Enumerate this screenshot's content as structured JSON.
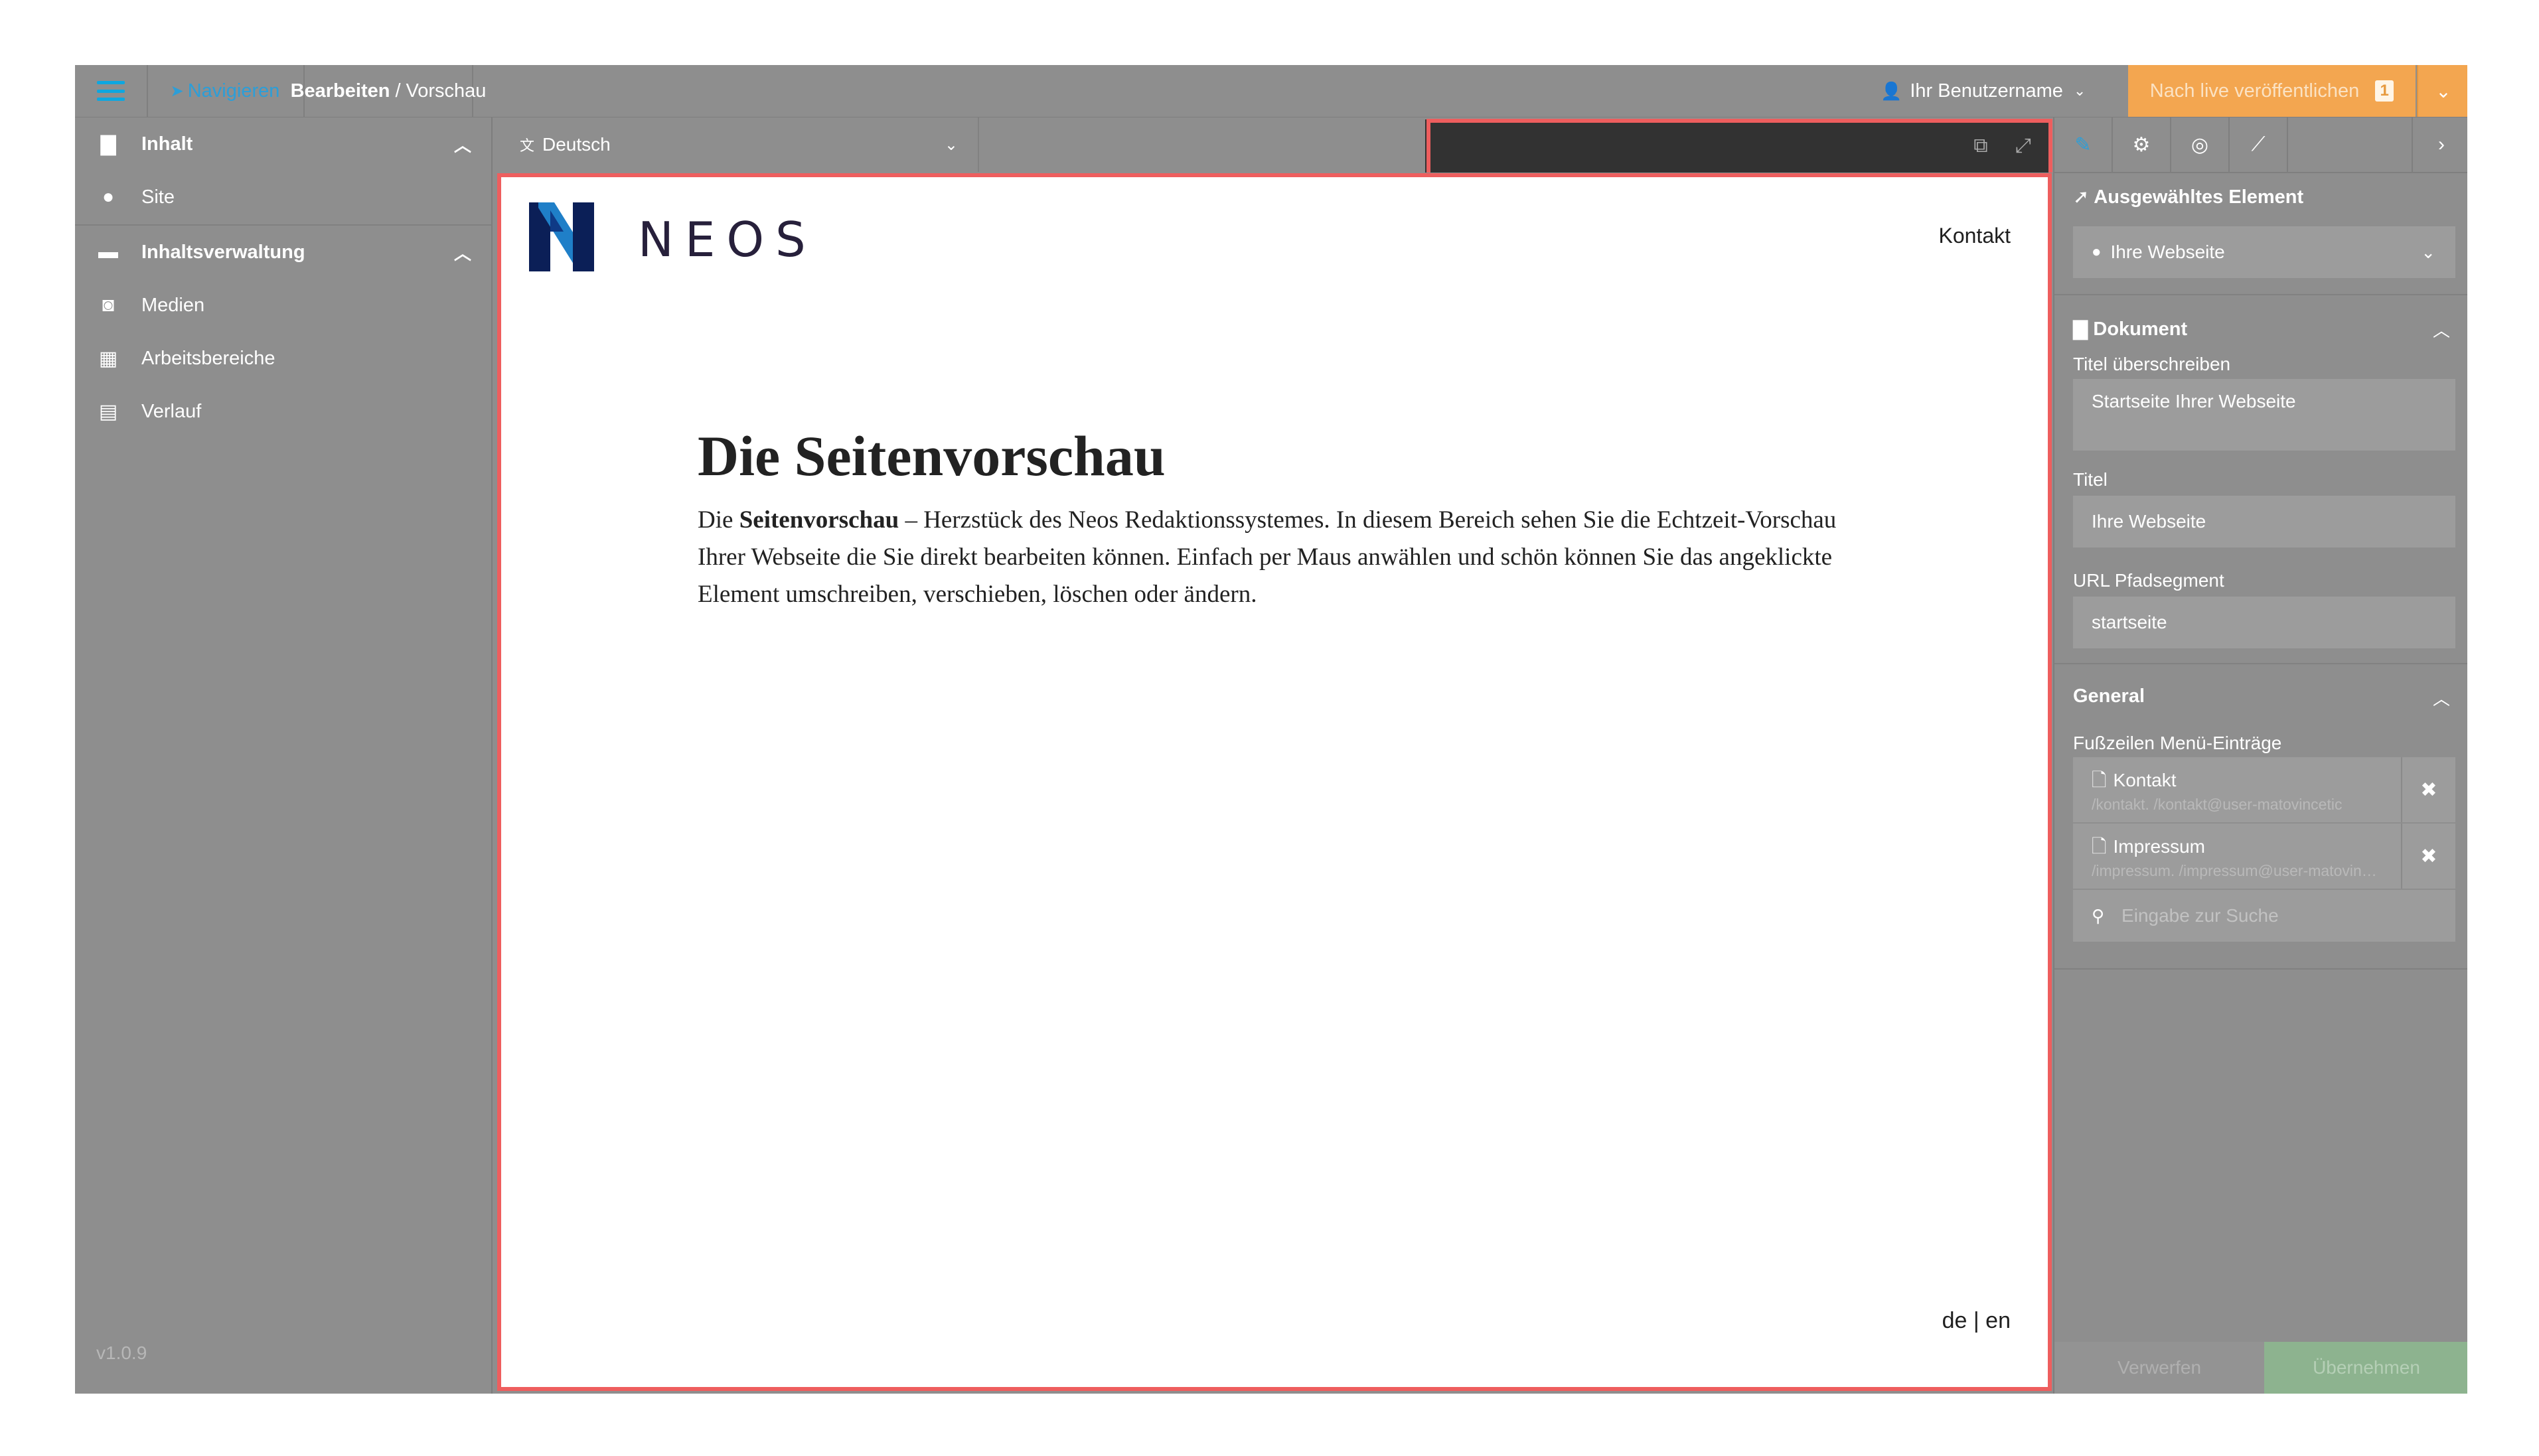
{
  "topbar": {
    "nav_label": "Navigieren",
    "crumb_bold": "Bearbeiten",
    "crumb_sep": "/",
    "crumb_rest": "Vorschau",
    "username": "Ihr Benutzername",
    "publish_label": "Nach live veröffentlichen",
    "publish_count": "1"
  },
  "sidebar": {
    "groups": [
      {
        "label": "Inhalt",
        "items": [
          "Site"
        ]
      },
      {
        "label": "Inhaltsverwaltung",
        "items": [
          "Medien",
          "Arbeitsbereiche",
          "Verlauf"
        ]
      }
    ],
    "version": "v1.0.9"
  },
  "content": {
    "language": "Deutsch"
  },
  "preview": {
    "brand": "NEOS",
    "nav_link": "Kontakt",
    "heading": "Die Seitenvorschau",
    "para_start": "Die ",
    "para_bold": "Seitenvorschau",
    "para_rest": " – Herzstück des Neos Redaktionssystemes. In diesem Bereich sehen Sie die Echtzeit-Vorschau Ihrer Webseite die Sie direkt bearbeiten können. Einfach per Maus anwählen und schön können Sie das angeklickte Element umschreiben, verschieben, löschen oder ändern.",
    "lang_links": "de | en"
  },
  "inspector": {
    "selected_title": "Ausgewähltes Element",
    "selected_value": "Ihre Webseite",
    "doc_title": "Dokument",
    "fields": [
      {
        "label": "Titel überschreiben",
        "value": "Startseite Ihrer Webseite"
      },
      {
        "label": "Titel",
        "value": "Ihre Webseite"
      },
      {
        "label": "URL Pfadsegment",
        "value": "startseite"
      }
    ],
    "general_title": "General",
    "footer_label": "Fußzeilen Menü-Einträge",
    "refs": [
      {
        "title": "Kontakt",
        "path": "/kontakt. /kontakt@user-matovincetic"
      },
      {
        "title": "Impressum",
        "path": "/impressum. /impressum@user-matovincetic"
      }
    ],
    "search_placeholder": "Eingabe zur Suche",
    "discard": "Verwerfen",
    "apply": "Übernehmen"
  },
  "colors": {
    "accent_blue": "#2c9ed8",
    "publish_orange": "#f3a650",
    "highlight_red": "#ee5e5e",
    "apply_green": "#8db38f"
  }
}
